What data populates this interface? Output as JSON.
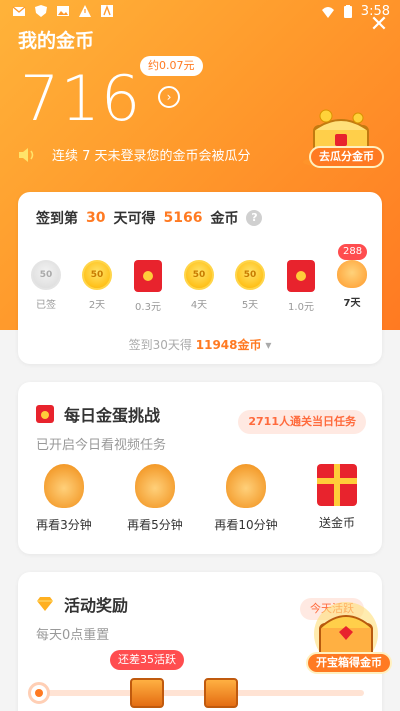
{
  "status_bar": {
    "time": "3:58",
    "icons": [
      "mail-icon",
      "shield-icon",
      "image-icon",
      "warning-icon",
      "text-icon",
      "wifi-icon",
      "battery-icon"
    ]
  },
  "header": {
    "title": "我的金币",
    "balance": "716",
    "approx_value": "约0.07元",
    "warning_text": "连续 7 天未登录您的金币会被瓜分",
    "treasure_button": "去瓜分金币"
  },
  "signin": {
    "prefix": "签到第",
    "days": "30",
    "middle": "天可得",
    "amount": "5166",
    "unit": "金币",
    "items": [
      {
        "label": "已签",
        "type": "coin-grey",
        "value": "50"
      },
      {
        "label": "2天",
        "type": "coin",
        "value": "50"
      },
      {
        "label": "0.3元",
        "type": "redpack",
        "value": ""
      },
      {
        "label": "4天",
        "type": "coin",
        "value": "50"
      },
      {
        "label": "5天",
        "type": "coin",
        "value": "50"
      },
      {
        "label": "1.0元",
        "type": "redpack",
        "value": ""
      },
      {
        "label": "7天",
        "type": "bag",
        "value": "288"
      }
    ],
    "footer_prefix": "签到30天得",
    "footer_amount": "11948金币"
  },
  "egg_challenge": {
    "title": "每日金蛋挑战",
    "subtitle": "已开启今日看视频任务",
    "pill": "2711人通关当日任务",
    "items": [
      {
        "label": "再看3分钟"
      },
      {
        "label": "再看5分钟"
      },
      {
        "label": "再看10分钟"
      },
      {
        "label": "送金币"
      }
    ]
  },
  "activity": {
    "title": "活动奖励",
    "subtitle": "每天0点重置",
    "today_pill": "今天活跃",
    "gap_pill": "还差35活跃"
  },
  "floating": {
    "button": "开宝箱得金币"
  },
  "colors": {
    "accent": "#ff7a22",
    "hero_start": "#ffb33a",
    "hero_end": "#ff7a22",
    "red": "#e8232d",
    "badge_red": "#ff4d4f"
  }
}
